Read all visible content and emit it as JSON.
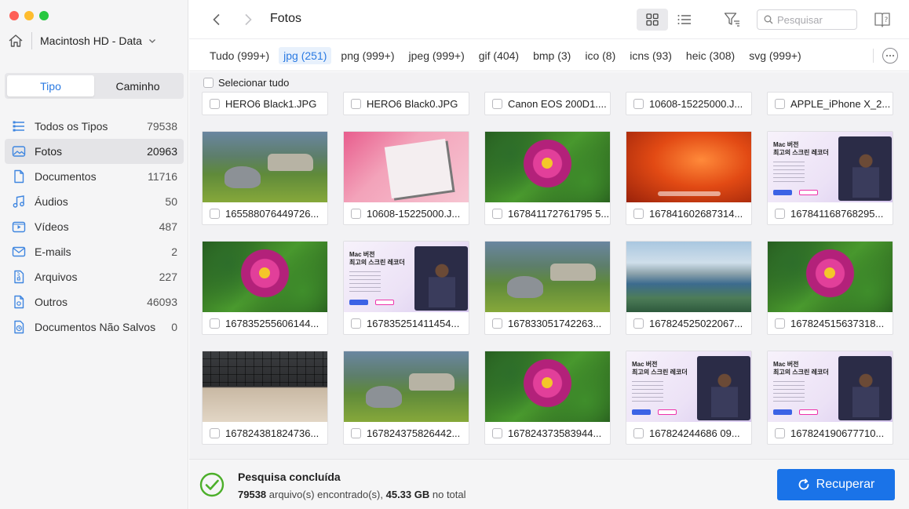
{
  "sidebar": {
    "drive_label": "Macintosh HD - Data",
    "segments": [
      {
        "label": "Tipo",
        "active": true
      },
      {
        "label": "Caminho",
        "active": false
      }
    ],
    "categories": [
      {
        "name": "Todos os Tipos",
        "count": "79538",
        "icon": "all-types-icon"
      },
      {
        "name": "Fotos",
        "count": "20963",
        "icon": "photo-icon",
        "active": true
      },
      {
        "name": "Documentos",
        "count": "11716",
        "icon": "document-icon"
      },
      {
        "name": "Áudios",
        "count": "50",
        "icon": "music-icon"
      },
      {
        "name": "Vídeos",
        "count": "487",
        "icon": "video-icon"
      },
      {
        "name": "E-mails",
        "count": "2",
        "icon": "mail-icon"
      },
      {
        "name": "Arquivos",
        "count": "227",
        "icon": "archive-icon"
      },
      {
        "name": "Outros",
        "count": "46093",
        "icon": "other-icon"
      },
      {
        "name": "Documentos Não Salvos",
        "count": "0",
        "icon": "unsaved-document-icon"
      }
    ]
  },
  "toolbar": {
    "title": "Fotos",
    "search_placeholder": "Pesquisar"
  },
  "type_tabs": [
    {
      "label": "Tudo (999+)"
    },
    {
      "label": "jpg (251)",
      "active": true
    },
    {
      "label": "png (999+)"
    },
    {
      "label": "jpeg (999+)"
    },
    {
      "label": "gif (404)"
    },
    {
      "label": "bmp (3)"
    },
    {
      "label": "ico (8)"
    },
    {
      "label": "icns (93)"
    },
    {
      "label": "heic (308)"
    },
    {
      "label": "svg (999+)"
    }
  ],
  "content": {
    "select_all_label": "Selecionar tudo",
    "top_row": [
      "HERO6 Black1.JPG",
      "HERO6 Black0.JPG",
      "Canon EOS 200D1....",
      "10608-15225000.J...",
      "APPLE_iPhone X_2..."
    ],
    "rows": [
      [
        {
          "name": "165588076449726...",
          "thumb": "rhino"
        },
        {
          "name": "10608-15225000.J...",
          "thumb": "paper"
        },
        {
          "name": "167841172761795 5...",
          "thumb": "flower"
        },
        {
          "name": "167841602687314...",
          "thumb": "ventura"
        },
        {
          "name": "167841168768295...",
          "thumb": "promo"
        }
      ],
      [
        {
          "name": "167835255606144...",
          "thumb": "flower"
        },
        {
          "name": "167835251411454...",
          "thumb": "promo"
        },
        {
          "name": "167833051742263...",
          "thumb": "rhino"
        },
        {
          "name": "167824525022067...",
          "thumb": "city"
        },
        {
          "name": "167824515637318...",
          "thumb": "flower"
        }
      ],
      [
        {
          "name": "167824381824736...",
          "thumb": "keyboard"
        },
        {
          "name": "167824375826442...",
          "thumb": "rhino"
        },
        {
          "name": "167824373583944...",
          "thumb": "flower"
        },
        {
          "name": "167824244686 09...",
          "thumb": "promo"
        },
        {
          "name": "167824190677710...",
          "thumb": "promo"
        }
      ]
    ],
    "promo_title": "Mac 버전\n최고의 스크린 레코더"
  },
  "status": {
    "title": "Pesquisa concluída",
    "file_count": "79538",
    "files_text": " arquivo(s) encontrado(s), ",
    "size": "45.33 GB",
    "size_suffix": " no total",
    "recover_label": "Recuperar"
  },
  "colors": {
    "accent": "#1a73e8",
    "active_tab_text": "#2a7ae2",
    "success": "#4caf2a"
  }
}
